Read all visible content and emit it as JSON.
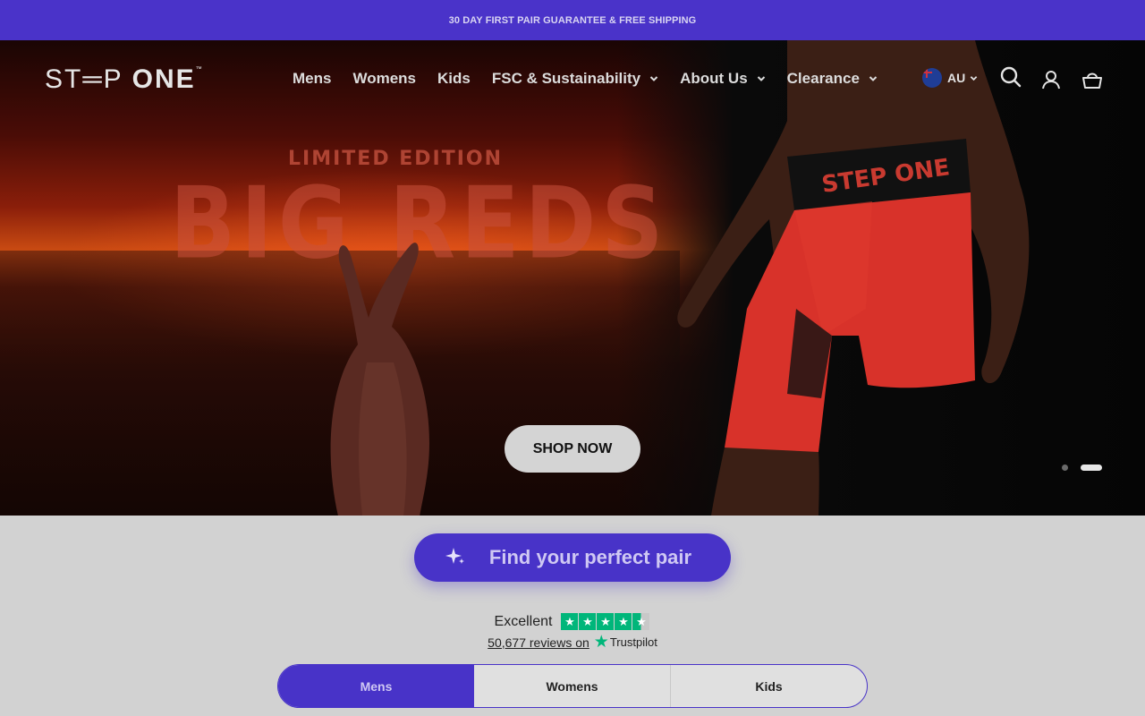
{
  "announcement": "30 DAY FIRST PAIR GUARANTEE & FREE SHIPPING",
  "logo": {
    "text_left": "ST═P",
    "text_right": "ONE",
    "tm": "™"
  },
  "nav": {
    "items": [
      {
        "label": "Mens",
        "has_dropdown": false
      },
      {
        "label": "Womens",
        "has_dropdown": false
      },
      {
        "label": "Kids",
        "has_dropdown": false
      },
      {
        "label": "FSC & Sustainability",
        "has_dropdown": true
      },
      {
        "label": "About Us",
        "has_dropdown": true
      },
      {
        "label": "Clearance",
        "has_dropdown": true
      }
    ]
  },
  "locale": {
    "code": "AU",
    "flag": "australia-flag-icon"
  },
  "icons": {
    "search": "search-icon",
    "account": "account-icon",
    "cart": "cart-icon"
  },
  "hero": {
    "overlay_title": "BIG REDS",
    "overlay_subtitle": "LIMITED EDITION",
    "waistband_text": "STEP ONE",
    "cta": "SHOP NOW",
    "slides_total": 2,
    "active_slide": 2
  },
  "finder": {
    "label": "Find your perfect pair",
    "icon": "sparkle-icon"
  },
  "trustpilot": {
    "rating_word": "Excellent",
    "stars": 4.5,
    "reviews_text": "50,677 reviews on",
    "brand": "Trustpilot"
  },
  "tabs": [
    {
      "label": "Mens",
      "active": true
    },
    {
      "label": "Womens",
      "active": false
    },
    {
      "label": "Kids",
      "active": false
    }
  ],
  "colors": {
    "brand_purple": "#4a33c9",
    "trustpilot_green": "#00b67a"
  }
}
